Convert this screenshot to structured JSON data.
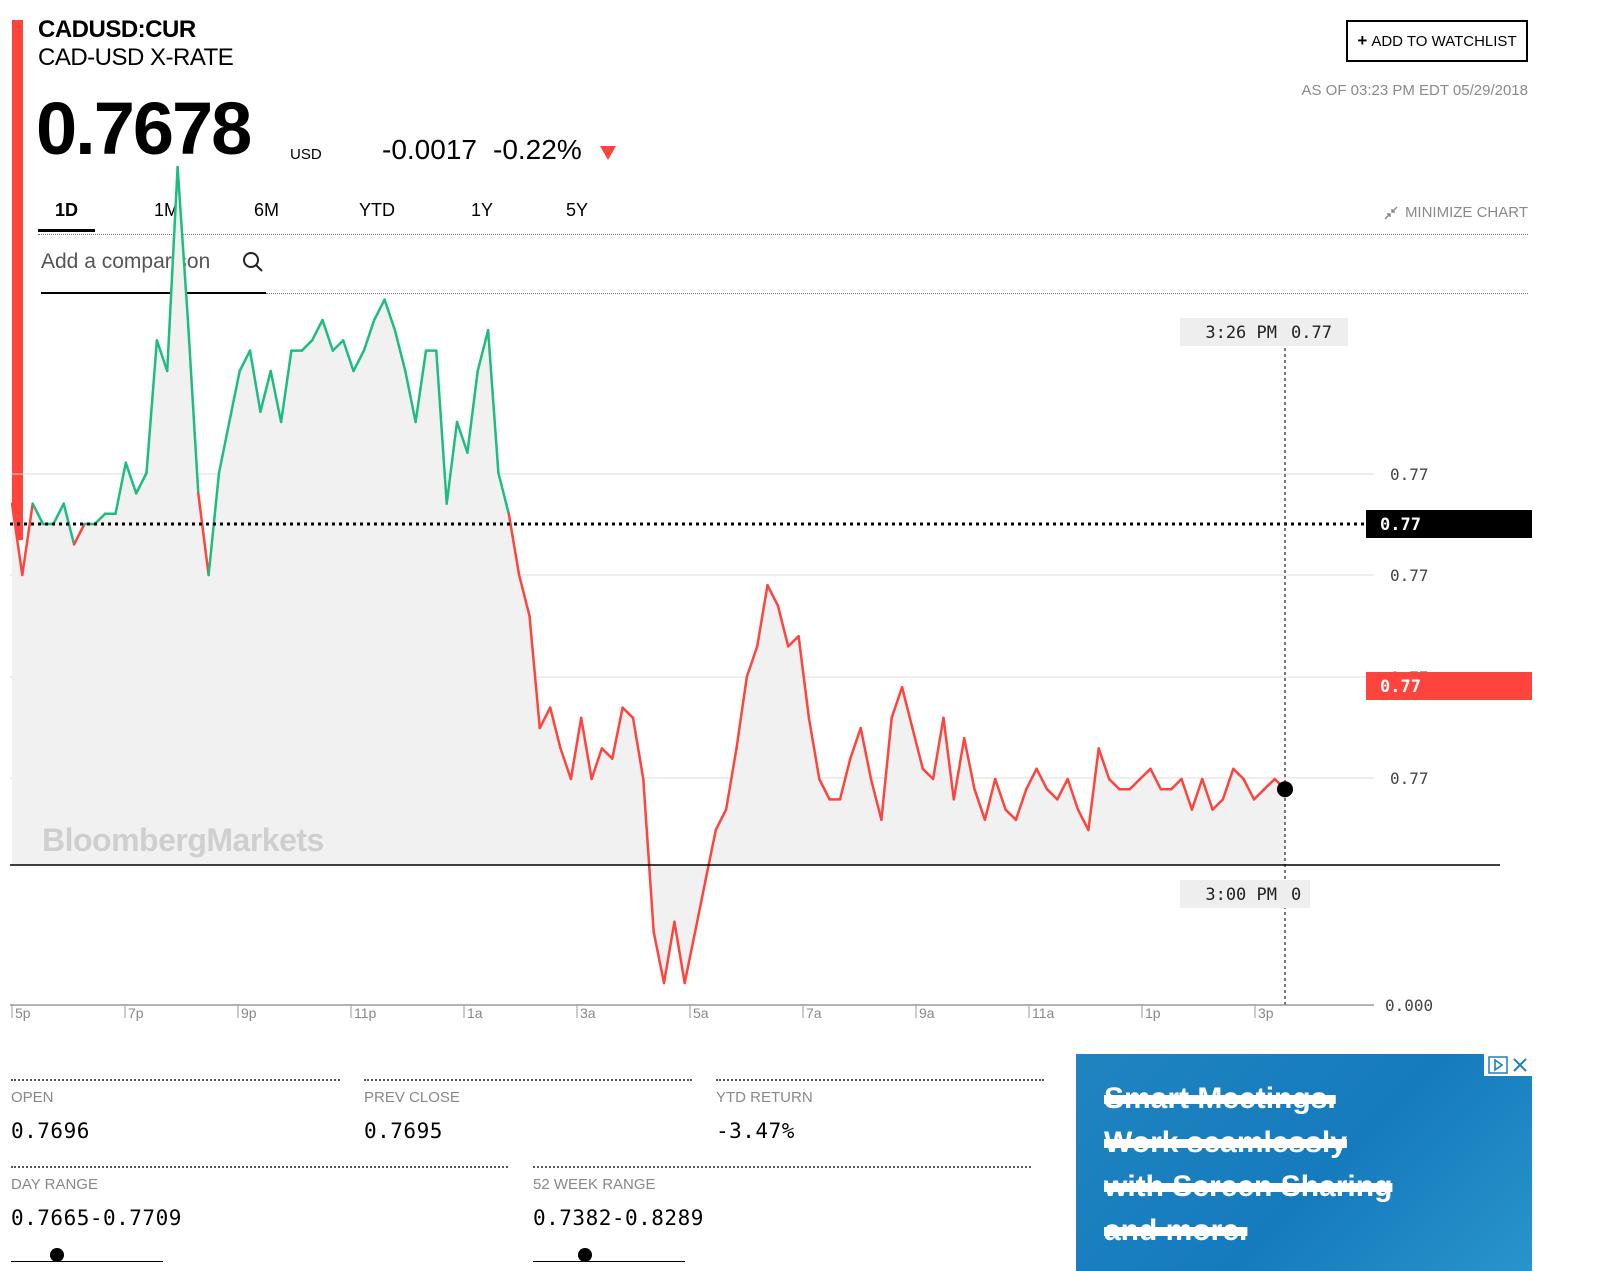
{
  "quote": {
    "ticker": "CADUSD:CUR",
    "name": "CAD-USD X-RATE",
    "price": "0.7678",
    "currency": "USD",
    "change": "-0.0017",
    "change_pct": "-0.22%",
    "direction": "down",
    "as_of": "AS OF 03:23 PM EDT 05/29/2018"
  },
  "actions": {
    "watchlist": "ADD TO WATCHLIST",
    "minimize": "MINIMIZE CHART"
  },
  "tabs": [
    "1D",
    "1M",
    "6M",
    "YTD",
    "1Y",
    "5Y"
  ],
  "active_tab": "1D",
  "comparison": {
    "placeholder": "Add a comparison"
  },
  "watermark": "BloombergMarkets",
  "colors": {
    "up": "#1dbd80",
    "down": "#ff433d",
    "accent": "#ff433d",
    "ad_bg": "#1a7fbf"
  },
  "chart_data": {
    "type": "line",
    "x_ticks": [
      "5p",
      "7p",
      "9p",
      "11p",
      "1a",
      "3a",
      "5a",
      "7a",
      "9a",
      "11a",
      "1p",
      "3p"
    ],
    "y_ticks": [
      "0.77",
      "0.77",
      "0.77",
      "0.77"
    ],
    "prev_close_label": "0.77",
    "current_label": "0.77",
    "crosshair_time": "3:26 PM",
    "crosshair_value": "0.77",
    "volume_time": "3:00 PM",
    "volume_value": "0",
    "volume_axis": "0.000",
    "prev_close": 0.7695,
    "last": 0.7678,
    "series": [
      {
        "values": [
          0.7697,
          0.769,
          0.7697,
          0.7695,
          0.7695,
          0.7697,
          0.7693,
          0.7695,
          0.7695,
          0.7696,
          0.7696,
          0.7701,
          0.7698,
          0.77,
          0.7713,
          0.771,
          0.773,
          0.7715,
          0.7698,
          0.769,
          0.77,
          0.7705,
          0.771,
          0.7712,
          0.7706,
          0.771,
          0.7705,
          0.7712,
          0.7712,
          0.7713,
          0.7715,
          0.7712,
          0.7713,
          0.771,
          0.7712,
          0.7715,
          0.7717,
          0.7714,
          0.771,
          0.7705,
          0.7712,
          0.7712,
          0.7697,
          0.7705,
          0.7702,
          0.771,
          0.7714,
          0.77,
          0.7696,
          0.769,
          0.7686,
          0.7675,
          0.7677,
          0.7673,
          0.767,
          0.7676,
          0.767,
          0.7673,
          0.7672,
          0.7677,
          0.7676,
          0.767,
          0.7655,
          0.765,
          0.7656,
          0.765,
          0.7655,
          0.766,
          0.7665,
          0.7667,
          0.7673,
          0.768,
          0.7683,
          0.7689,
          0.7687,
          0.7683,
          0.7684,
          0.7676,
          0.767,
          0.7668,
          0.7668,
          0.7672,
          0.7675,
          0.767,
          0.7666,
          0.7676,
          0.7679,
          0.7675,
          0.7671,
          0.767,
          0.7676,
          0.7668,
          0.7674,
          0.7669,
          0.7666,
          0.767,
          0.7667,
          0.7666,
          0.7669,
          0.7671,
          0.7669,
          0.7668,
          0.767,
          0.7667,
          0.7665,
          0.7673,
          0.767,
          0.7669,
          0.7669,
          0.767,
          0.7671,
          0.7669,
          0.7669,
          0.767,
          0.7667,
          0.767,
          0.7667,
          0.7668,
          0.7671,
          0.767,
          0.7668,
          0.7669,
          0.767,
          0.7669
        ]
      }
    ],
    "grid": true
  },
  "stats": {
    "open": {
      "label": "OPEN",
      "value": "0.7696"
    },
    "prev_close": {
      "label": "PREV CLOSE",
      "value": "0.7695"
    },
    "ytd_return": {
      "label": "YTD RETURN",
      "value": "-3.47%"
    },
    "day_range": {
      "label": "DAY RANGE",
      "value": "0.7665-0.7709",
      "position": 0.3
    },
    "week52_range": {
      "label": "52 WEEK RANGE",
      "value": "0.7382-0.8289",
      "position": 0.34
    }
  },
  "ad": {
    "lines": [
      "Smart Meetings.",
      "Work seamlessly",
      "with Screen Sharing",
      "and more."
    ]
  }
}
